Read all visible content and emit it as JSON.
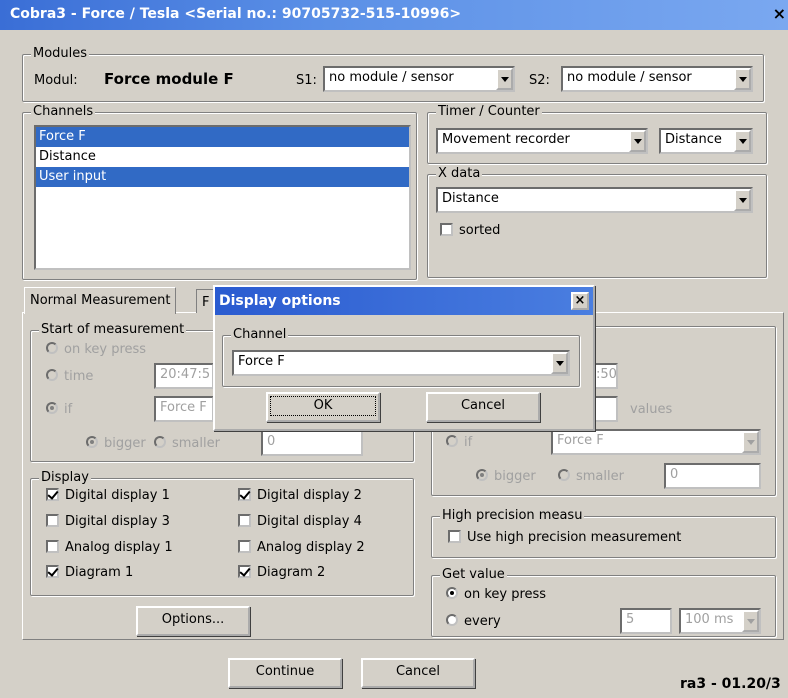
{
  "window": {
    "title": "Cobra3 - Force / Tesla  <Serial no.: 90705732-515-10996>",
    "close": "×"
  },
  "modules": {
    "legend": "Modules",
    "modul_label": "Modul:",
    "modul_value": "Force module F",
    "s1_label": "S1:",
    "s1_value": "no module / sensor",
    "s2_label": "S2:",
    "s2_value": "no module / sensor"
  },
  "channels": {
    "legend": "Channels",
    "items": [
      "Force F",
      "Distance",
      "User input"
    ]
  },
  "timer": {
    "legend": "Timer / Counter",
    "mode": "Movement recorder",
    "unit": "Distance"
  },
  "xdata": {
    "legend": "X data",
    "value": "Distance",
    "sorted_label": "sorted"
  },
  "tabs": [
    "Normal Measurement",
    "F"
  ],
  "start": {
    "legend": "Start of measurement",
    "on_key": "on key press",
    "time": "time",
    "time_value": "20:47:5",
    "if": "if",
    "if_value": "Force F",
    "bigger": "bigger",
    "smaller": "smaller",
    "threshold": "0"
  },
  "display": {
    "legend": "Display",
    "items": [
      "Digital display 1",
      "Digital display 2",
      "Digital display 3",
      "Digital display 4",
      "Analog display 1",
      "Analog display 2",
      "Diagram 1",
      "Diagram 2"
    ]
  },
  "options_button": "Options...",
  "stop": {
    "time_value": ":50",
    "values_label": "values",
    "if": "if",
    "if_value": "Force F",
    "bigger": "bigger",
    "smaller": "smaller",
    "threshold": "0"
  },
  "highprec": {
    "legend": "High precision measu",
    "label": "Use high precision measurement"
  },
  "getvalue": {
    "legend": "Get value",
    "on_key": "on key press",
    "every": "every",
    "every_value": "5",
    "interval": "100 ms"
  },
  "footer": {
    "continue": "Continue",
    "cancel": "Cancel",
    "version": "ra3 - 01.20/3"
  },
  "dialog": {
    "title": "Display options",
    "close": "×",
    "channel_legend": "Channel",
    "channel_value": "Force F",
    "ok": "OK",
    "cancel": "Cancel"
  }
}
